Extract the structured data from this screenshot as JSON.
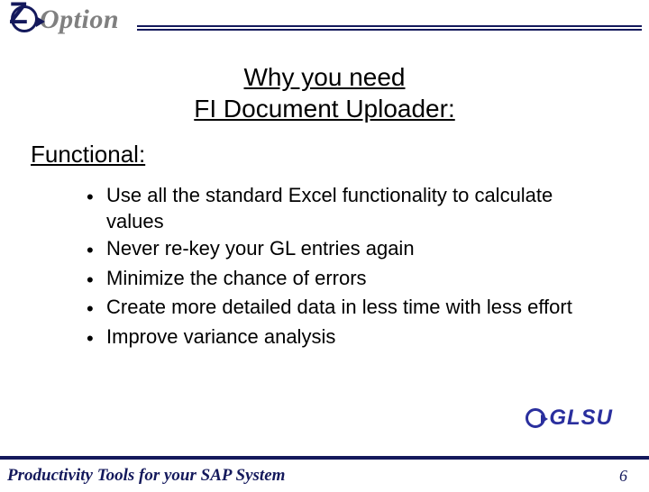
{
  "brand": {
    "z": "Z",
    "option": "Option"
  },
  "title": {
    "line1": "Why you need",
    "line2": "FI Document Uploader:"
  },
  "subhead": "Functional:",
  "bullets": [
    "Use all the standard Excel functionality to calculate values",
    "Never re-key your GL entries again",
    "Minimize the chance of errors",
    "Create more detailed data in less time with less effort",
    "Improve variance analysis"
  ],
  "glsu": "GLSU",
  "footer": {
    "text": "Productivity Tools for your SAP System",
    "page": "6"
  }
}
